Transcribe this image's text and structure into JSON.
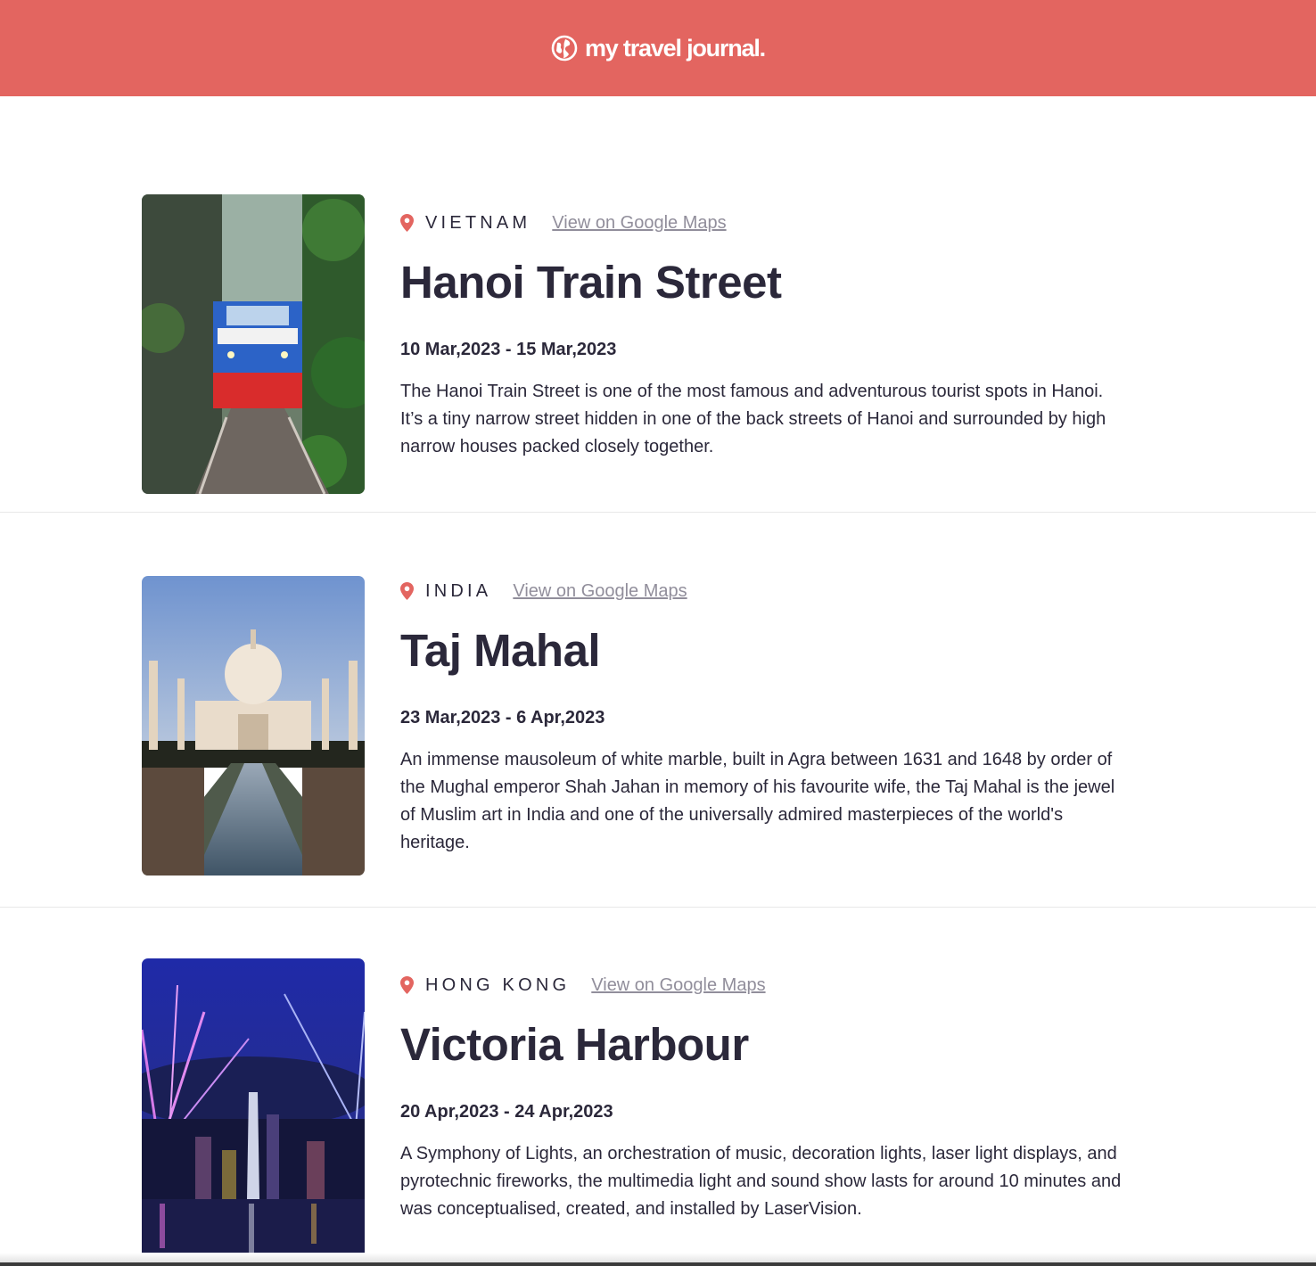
{
  "header": {
    "title": "my travel journal.",
    "icon": "globe-icon",
    "background": "#E36560"
  },
  "entries": [
    {
      "country": "VIETNAM",
      "maps_link": "View on Google Maps",
      "title": "Hanoi Train Street",
      "dates": "10 Mar,2023 - 15 Mar,2023",
      "description": "The Hanoi Train Street is one of the most famous and adventurous tourist spots in Hanoi. It’s a tiny narrow street hidden in one of the back streets of Hanoi and surrounded by high narrow houses packed closely together."
    },
    {
      "country": "INDIA",
      "maps_link": "View on Google Maps",
      "title": "Taj Mahal",
      "dates": "23 Mar,2023 - 6 Apr,2023",
      "description": "An immense mausoleum of white marble, built in Agra between 1631 and 1648 by order of the Mughal emperor Shah Jahan in memory of his favourite wife, the Taj Mahal is the jewel of Muslim art in India and one of the universally admired masterpieces of the world's heritage."
    },
    {
      "country": "HONG KONG",
      "maps_link": "View on Google Maps",
      "title": "Victoria Harbour",
      "dates": "20 Apr,2023 - 24 Apr,2023",
      "description": "A Symphony of Lights, an orchestration of music, decoration lights, laser light displays, and pyrotechnic fireworks, the multimedia light and sound show lasts for around 10 minutes and was conceptualised, created, and installed by LaserVision."
    }
  ],
  "colors": {
    "accent": "#E36560",
    "text": "#2B283A",
    "link": "#918E9B"
  }
}
